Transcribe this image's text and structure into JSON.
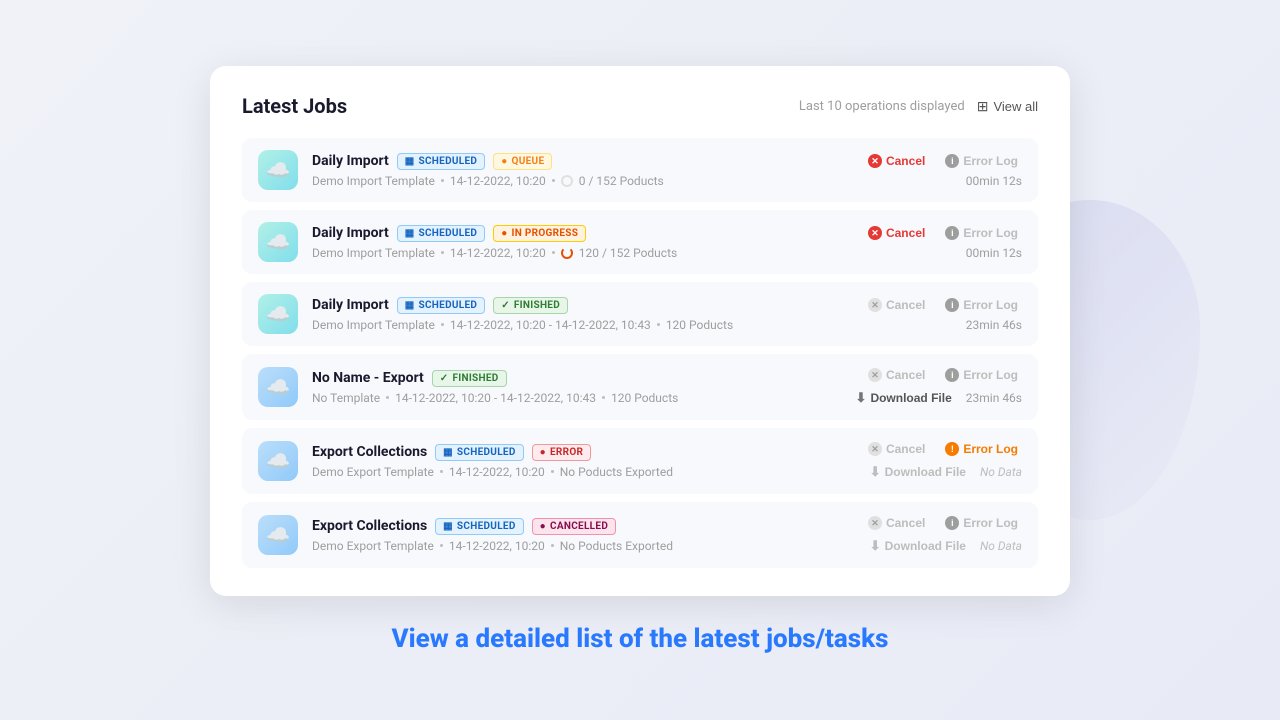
{
  "page": {
    "background": "#f0f2f8",
    "tagline": "View a detailed list of the latest jobs/tasks"
  },
  "card": {
    "title": "Latest Jobs",
    "last_ops_label": "Last 10 operations displayed",
    "view_all_label": "View all"
  },
  "jobs": [
    {
      "id": 1,
      "name": "Daily Import",
      "type": "import",
      "badges": [
        {
          "label": "SCHEDULED",
          "type": "scheduled",
          "icon": "▦"
        },
        {
          "label": "QUEUE",
          "type": "queue",
          "icon": "●"
        }
      ],
      "template": "Demo Import Template",
      "date": "14-12-2022, 10:20",
      "progress": "0 / 152 Poducts",
      "has_progress_circle": true,
      "cancel_active": true,
      "cancel_label": "Cancel",
      "error_log_active": false,
      "error_log_label": "Error Log",
      "download_label": "",
      "time_label": "00min 12s",
      "show_download": false,
      "no_data": false
    },
    {
      "id": 2,
      "name": "Daily Import",
      "type": "import",
      "badges": [
        {
          "label": "SCHEDULED",
          "type": "scheduled",
          "icon": "▦"
        },
        {
          "label": "IN PROGRESS",
          "type": "in-progress",
          "icon": "●"
        }
      ],
      "template": "Demo Import Template",
      "date": "14-12-2022, 10:20",
      "progress": "120 / 152 Poducts",
      "has_progress_spinner": true,
      "cancel_active": true,
      "cancel_label": "Cancel",
      "error_log_active": false,
      "error_log_label": "Error Log",
      "download_label": "",
      "time_label": "00min 12s",
      "show_download": false,
      "no_data": false
    },
    {
      "id": 3,
      "name": "Daily Import",
      "type": "import",
      "badges": [
        {
          "label": "SCHEDULED",
          "type": "scheduled",
          "icon": "▦"
        },
        {
          "label": "FINISHED",
          "type": "finished",
          "icon": "✓"
        }
      ],
      "template": "Demo Import Template",
      "date_range": "14-12-2022, 10:20 - 14-12-2022, 10:43",
      "progress": "120 Poducts",
      "cancel_active": false,
      "cancel_label": "Cancel",
      "error_log_active": false,
      "error_log_label": "Error Log",
      "download_label": "",
      "time_label": "23min 46s",
      "show_download": false,
      "no_data": false
    },
    {
      "id": 4,
      "name": "No Name - Export",
      "type": "export",
      "badges": [
        {
          "label": "FINISHED",
          "type": "finished",
          "icon": "✓"
        }
      ],
      "template": "No Template",
      "date_range": "14-12-2022, 10:20 - 14-12-2022, 10:43",
      "progress": "120 Poducts",
      "cancel_active": false,
      "cancel_label": "Cancel",
      "error_log_active": false,
      "error_log_label": "Error Log",
      "download_label": "Download File",
      "time_label": "23min 46s",
      "show_download": true,
      "no_data": false
    },
    {
      "id": 5,
      "name": "Export Collections",
      "type": "export",
      "badges": [
        {
          "label": "SCHEDULED",
          "type": "scheduled",
          "icon": "▦"
        },
        {
          "label": "ERROR",
          "type": "error",
          "icon": "●"
        }
      ],
      "template": "Demo Export Template",
      "date": "14-12-2022, 10:20",
      "progress": "No Poducts Exported",
      "cancel_active": false,
      "cancel_label": "Cancel",
      "error_log_active": true,
      "error_log_label": "Error Log",
      "download_label": "Download File",
      "time_label": "",
      "show_download": true,
      "download_disabled": true,
      "no_data": true
    },
    {
      "id": 6,
      "name": "Export Collections",
      "type": "export",
      "badges": [
        {
          "label": "SCHEDULED",
          "type": "scheduled",
          "icon": "▦"
        },
        {
          "label": "CANCELLED",
          "type": "cancelled",
          "icon": "●"
        }
      ],
      "template": "Demo Export Template",
      "date": "14-12-2022, 10:20",
      "progress": "No Poducts Exported",
      "cancel_active": false,
      "cancel_label": "Cancel",
      "error_log_active": false,
      "error_log_label": "Error Log",
      "download_label": "Download File",
      "time_label": "",
      "show_download": true,
      "download_disabled": true,
      "no_data": true
    }
  ]
}
